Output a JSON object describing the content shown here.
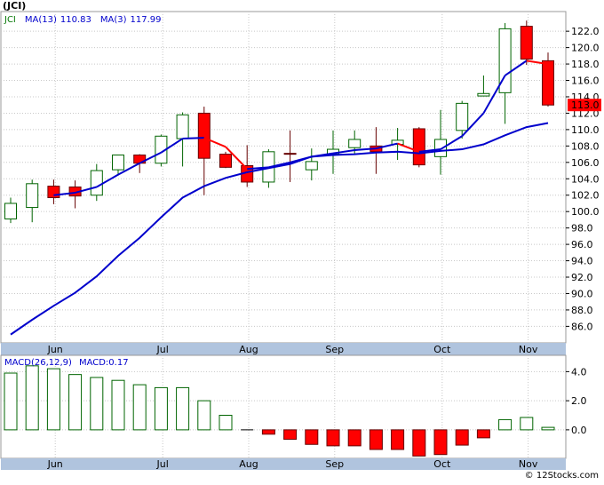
{
  "ticker_title": "(JCI)",
  "footer": "© 12Stocks.com",
  "colors": {
    "up_body": "#ffffff",
    "up_border": "#006400",
    "down_body": "#ff0000",
    "down_border": "#660000",
    "ma13": "#0000cc",
    "ma3_up": "#0000cc",
    "ma3_down": "#ff0000",
    "axis_band": "#b0c4de",
    "grid": "#c8c8c8",
    "price_tag": "#ff0000"
  },
  "chart_data": [
    {
      "type": "candlestick",
      "title": "JCI",
      "legend": [
        {
          "label": "JCI",
          "color": "#0a7a0a"
        },
        {
          "label": "MA(13)",
          "value": "110.83",
          "color": "#0000cc"
        },
        {
          "label": "MA(3)",
          "value": "117.99",
          "color": "#0000cc"
        }
      ],
      "current_price": "113.0",
      "x_tick_labels": [
        {
          "label": "Jun",
          "index": 1
        },
        {
          "label": "Jul",
          "index": 6
        },
        {
          "label": "Aug",
          "index": 10
        },
        {
          "label": "Sep",
          "index": 14
        },
        {
          "label": "Oct",
          "index": 19
        },
        {
          "label": "Nov",
          "index": 23
        }
      ],
      "y_ticks": [
        86.0,
        88.0,
        90.0,
        92.0,
        94.0,
        96.0,
        98.0,
        100.0,
        102.0,
        104.0,
        106.0,
        108.0,
        110.0,
        112.0,
        114.0,
        116.0,
        118.0,
        120.0,
        122.0
      ],
      "ylim": [
        84.2,
        124.4
      ],
      "grid": true,
      "candles": [
        {
          "o": 99.1,
          "h": 101.7,
          "l": 98.6,
          "c": 101.0
        },
        {
          "o": 100.5,
          "h": 103.9,
          "l": 98.7,
          "c": 103.4
        },
        {
          "o": 103.1,
          "h": 103.9,
          "l": 100.9,
          "c": 101.7
        },
        {
          "o": 103.0,
          "h": 103.8,
          "l": 100.4,
          "c": 101.9
        },
        {
          "o": 102.0,
          "h": 105.8,
          "l": 101.3,
          "c": 105.0
        },
        {
          "o": 105.1,
          "h": 106.9,
          "l": 104.4,
          "c": 106.9
        },
        {
          "o": 106.9,
          "h": 107.0,
          "l": 104.7,
          "c": 105.9
        },
        {
          "o": 105.9,
          "h": 109.4,
          "l": 105.5,
          "c": 109.2
        },
        {
          "o": 108.9,
          "h": 112.1,
          "l": 105.5,
          "c": 111.8
        },
        {
          "o": 112.0,
          "h": 112.8,
          "l": 102.0,
          "c": 106.5
        },
        {
          "o": 107.0,
          "h": 107.3,
          "l": 105.3,
          "c": 105.4
        },
        {
          "o": 105.6,
          "h": 108.1,
          "l": 103.0,
          "c": 103.6
        },
        {
          "o": 103.6,
          "h": 107.6,
          "l": 102.9,
          "c": 107.3
        },
        {
          "o": 107.1,
          "h": 109.9,
          "l": 103.6,
          "c": 107.0
        },
        {
          "o": 105.1,
          "h": 107.7,
          "l": 103.8,
          "c": 106.1
        },
        {
          "o": 107.0,
          "h": 109.9,
          "l": 104.6,
          "c": 107.6
        },
        {
          "o": 107.8,
          "h": 109.9,
          "l": 106.9,
          "c": 108.8
        },
        {
          "o": 108.0,
          "h": 110.3,
          "l": 104.6,
          "c": 107.3
        },
        {
          "o": 108.2,
          "h": 110.2,
          "l": 106.3,
          "c": 108.7
        },
        {
          "o": 110.1,
          "h": 110.3,
          "l": 105.4,
          "c": 105.7
        },
        {
          "o": 106.7,
          "h": 112.4,
          "l": 104.5,
          "c": 108.8
        },
        {
          "o": 109.9,
          "h": 113.5,
          "l": 108.9,
          "c": 113.2
        },
        {
          "o": 114.1,
          "h": 116.6,
          "l": 114.1,
          "c": 114.4
        },
        {
          "o": 114.5,
          "h": 123.0,
          "l": 110.7,
          "c": 122.3
        },
        {
          "o": 122.6,
          "h": 123.3,
          "l": 117.9,
          "c": 118.6
        },
        {
          "o": 118.4,
          "h": 119.4,
          "l": 112.8,
          "c": 113.0
        }
      ],
      "ma13": [
        85.0,
        86.8,
        88.5,
        90.1,
        92.1,
        94.6,
        96.8,
        99.3,
        101.7,
        103.1,
        104.1,
        104.8,
        105.3,
        105.8,
        106.7,
        106.9,
        107.0,
        107.2,
        107.3,
        107.1,
        107.4,
        107.6,
        108.2,
        109.3,
        110.3,
        110.8
      ],
      "ma3": [
        null,
        null,
        102.0,
        102.3,
        103.0,
        104.5,
        105.9,
        107.2,
        108.9,
        109.0,
        107.9,
        105.2,
        105.4,
        106.0,
        106.7,
        107.1,
        107.5,
        107.7,
        108.3,
        107.3,
        107.6,
        109.2,
        112.0,
        116.6,
        118.4,
        117.99
      ]
    },
    {
      "type": "bar",
      "title": "MACD(26,12,9)",
      "legend": [
        {
          "label": "MACD(26,12,9)",
          "color": "#0000cc"
        },
        {
          "label": "MACD:0.17",
          "color": "#0000cc"
        }
      ],
      "y_ticks": [
        4.0,
        2.0,
        0.0
      ],
      "ylim": [
        -1.9,
        5.0
      ],
      "values": [
        3.9,
        4.4,
        4.2,
        3.8,
        3.6,
        3.4,
        3.1,
        2.9,
        2.9,
        2.0,
        1.0,
        0.0,
        -0.3,
        -0.65,
        -1.0,
        -1.1,
        -1.1,
        -1.35,
        -1.35,
        -1.8,
        -1.7,
        -1.05,
        -0.55,
        0.7,
        0.85,
        0.17
      ]
    }
  ]
}
